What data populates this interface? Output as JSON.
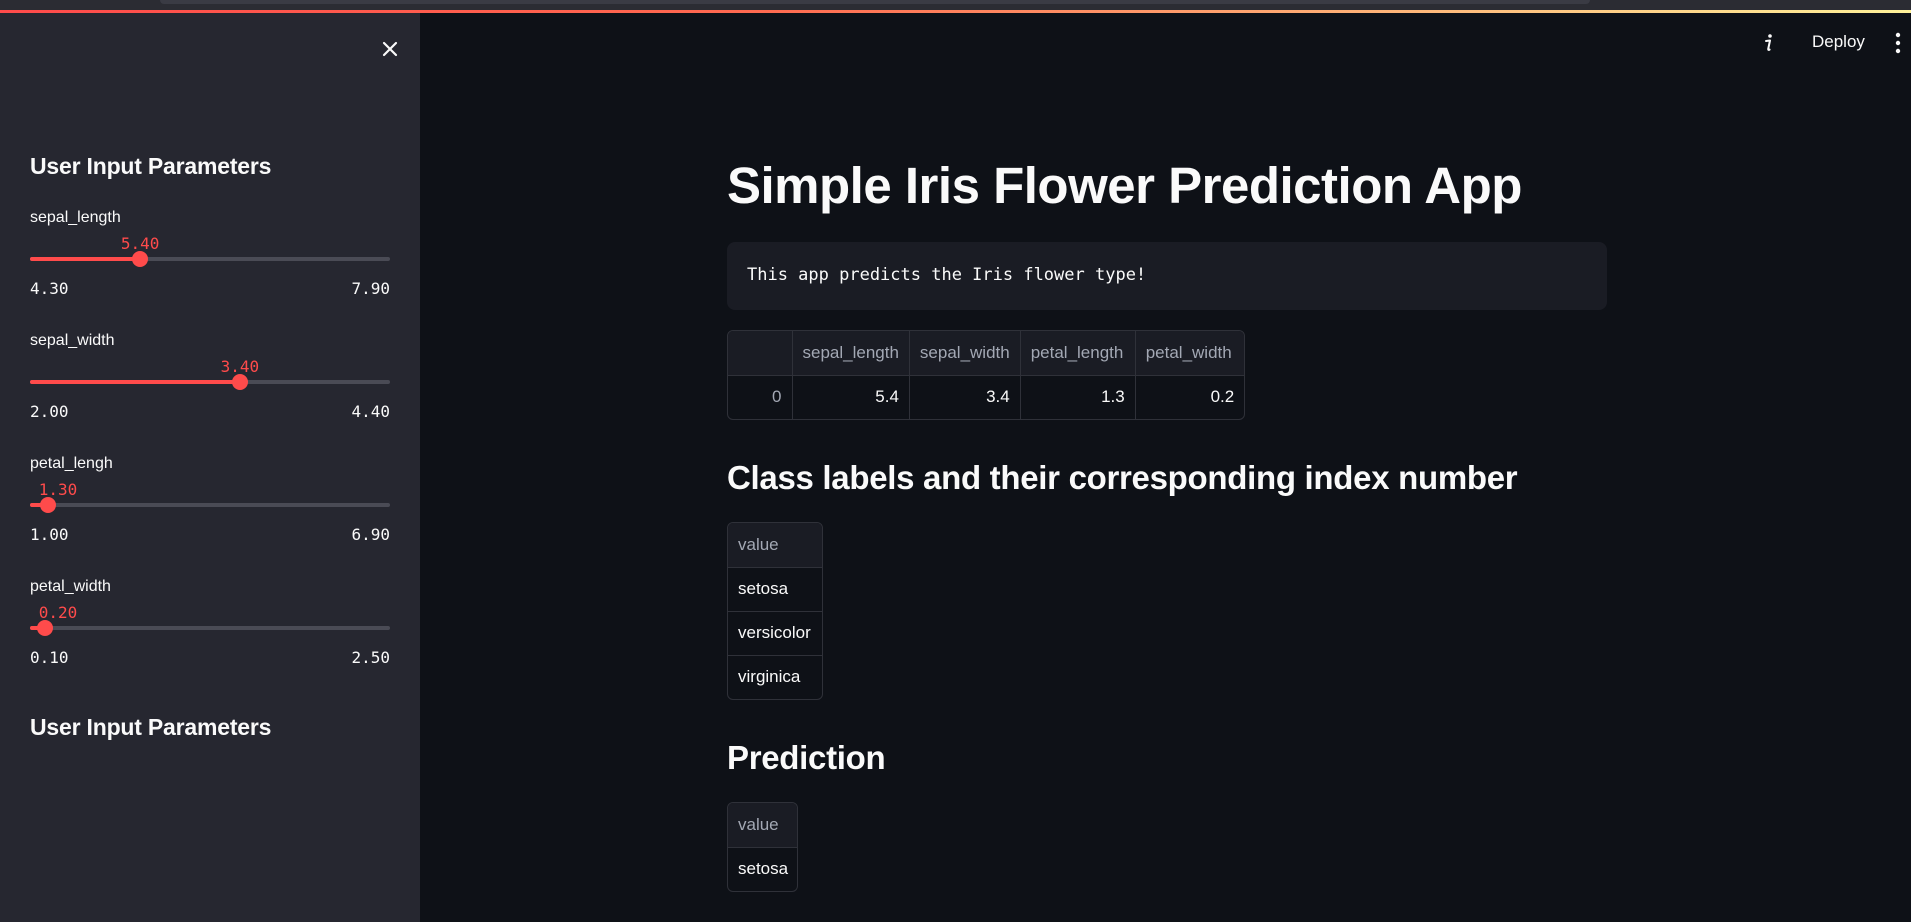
{
  "sidebar": {
    "heading": "User Input Parameters",
    "heading2": "User Input Parameters",
    "sliders": [
      {
        "label": "sepal_length",
        "value": "5.40",
        "min": "4.30",
        "max": "7.90",
        "fraction": 0.306
      },
      {
        "label": "sepal_width",
        "value": "3.40",
        "min": "2.00",
        "max": "4.40",
        "fraction": 0.583
      },
      {
        "label": "petal_lengh",
        "value": "1.30",
        "min": "1.00",
        "max": "6.90",
        "fraction": 0.051
      },
      {
        "label": "petal_width",
        "value": "0.20",
        "min": "0.10",
        "max": "2.50",
        "fraction": 0.042
      }
    ]
  },
  "header": {
    "deploy_label": "Deploy"
  },
  "main": {
    "title": "Simple Iris Flower Prediction App",
    "code_text": "This app predicts the Iris flower type!",
    "input_table": {
      "columns": [
        "sepal_length",
        "sepal_width",
        "petal_length",
        "petal_width"
      ],
      "rows": [
        {
          "index": "0",
          "values": [
            "5.4",
            "3.4",
            "1.3",
            "0.2"
          ]
        }
      ]
    },
    "classes_heading": "Class labels and their corresponding index number",
    "classes_table": {
      "header": "value",
      "rows": [
        "setosa",
        "versicolor",
        "virginica"
      ]
    },
    "prediction_heading": "Prediction",
    "prediction_table": {
      "header": "value",
      "rows": [
        "setosa"
      ]
    }
  },
  "colors": {
    "accent": "#ff4b4b",
    "sidebar_bg": "#262730",
    "main_bg": "#0e1117",
    "text": "#fafafa"
  },
  "icons": [
    "close-icon",
    "info-icon",
    "more-vertical-icon"
  ]
}
